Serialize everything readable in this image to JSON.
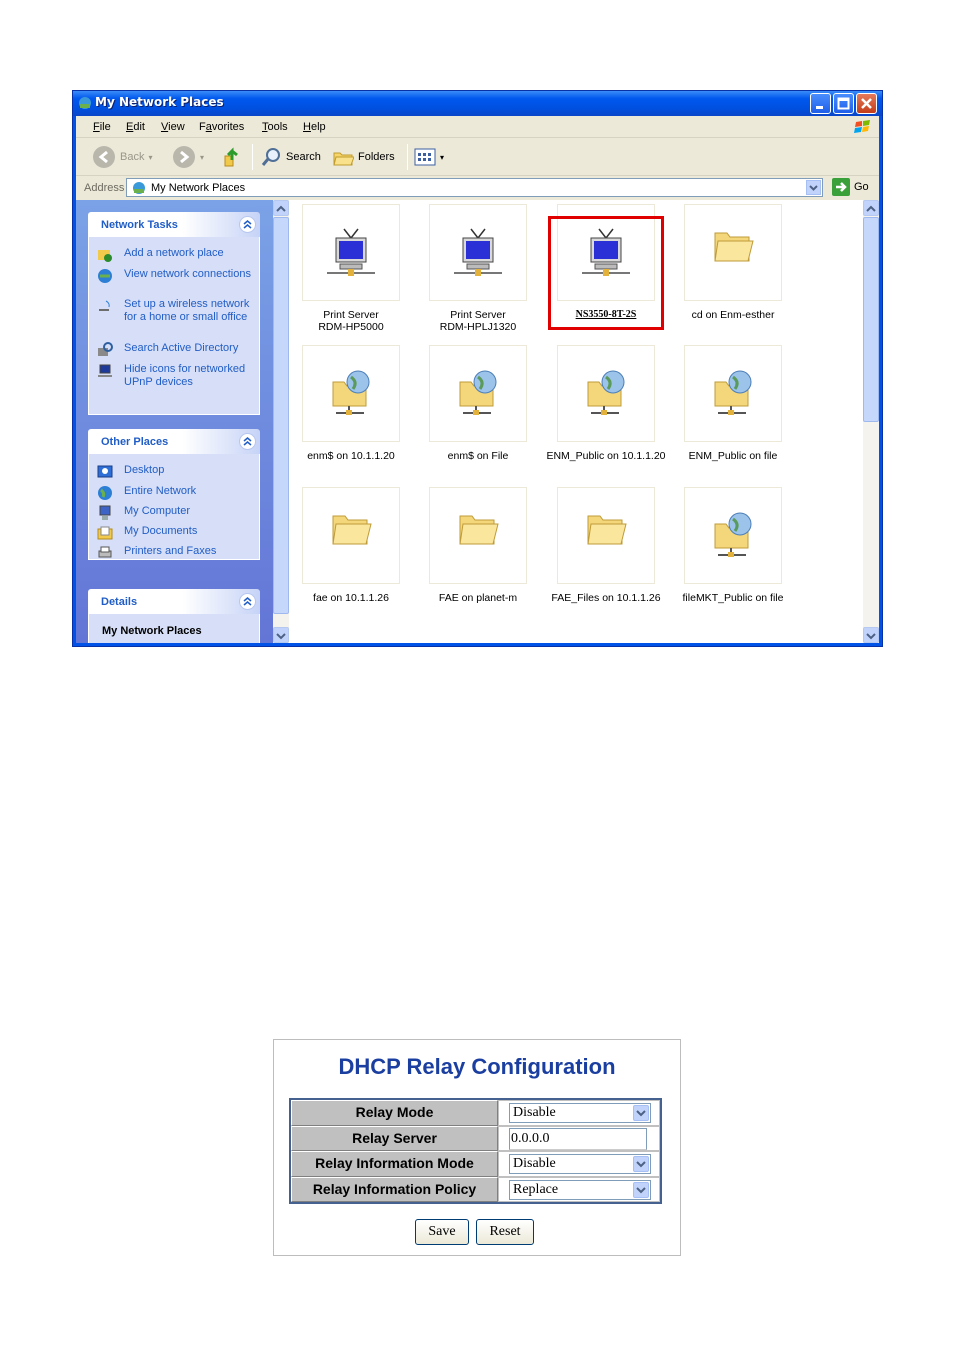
{
  "window": {
    "title": "My Network Places",
    "menu": [
      {
        "label": "File",
        "ul": "F",
        "rest": "ile"
      },
      {
        "label": "Edit",
        "ul": "E",
        "rest": "dit"
      },
      {
        "label": "View",
        "ul": "V",
        "rest": "iew"
      },
      {
        "label": "Favorites",
        "pre": "F",
        "ul": "a",
        "rest": "vorites"
      },
      {
        "label": "Tools",
        "ul": "T",
        "rest": "ools"
      },
      {
        "label": "Help",
        "ul": "H",
        "rest": "elp"
      }
    ],
    "toolbar": {
      "back": "Back",
      "search": "Search",
      "folders": "Folders"
    },
    "address": {
      "label": "Address",
      "value": "My Network Places",
      "go": "Go"
    }
  },
  "taskpane": {
    "network_tasks": {
      "title": "Network Tasks",
      "items": [
        {
          "label": "Add a network place",
          "icon": "add-network-place-icon"
        },
        {
          "label": "View network connections",
          "icon": "network-connections-icon"
        },
        {
          "label": "Set up a wireless network for a home or small office",
          "icon": "wireless-icon"
        },
        {
          "label": "Search Active Directory",
          "icon": "search-directory-icon"
        },
        {
          "label": "Hide icons for networked UPnP devices",
          "icon": "upnp-icon"
        }
      ]
    },
    "other_places": {
      "title": "Other Places",
      "items": [
        {
          "label": "Desktop",
          "icon": "desktop-icon"
        },
        {
          "label": "Entire Network",
          "icon": "globe-icon"
        },
        {
          "label": "My Computer",
          "icon": "computer-icon"
        },
        {
          "label": "My Documents",
          "icon": "documents-icon"
        },
        {
          "label": "Printers and Faxes",
          "icon": "printer-icon"
        }
      ]
    },
    "details": {
      "title": "Details",
      "subtitle": "My Network Places"
    }
  },
  "places": [
    {
      "line1": "Print Server",
      "line2": "RDM-HP5000",
      "icon": "network-device-icon"
    },
    {
      "line1": "Print Server",
      "line2": "RDM-HPLJ1320",
      "icon": "network-device-icon"
    },
    {
      "line1": "NS3550-8T-2S",
      "line2": "",
      "icon": "network-device-icon",
      "highlighted": true
    },
    {
      "line1": "cd on Enm-esther",
      "line2": "",
      "icon": "folder-icon"
    },
    {
      "line1": "enm$ on 10.1.1.20",
      "line2": "",
      "icon": "network-share-icon"
    },
    {
      "line1": "enm$ on File",
      "line2": "",
      "icon": "network-share-icon"
    },
    {
      "line1": "ENM_Public on 10.1.1.20",
      "line2": "",
      "icon": "network-share-icon"
    },
    {
      "line1": "ENM_Public on file",
      "line2": "",
      "icon": "network-share-icon"
    },
    {
      "line1": "fae on 10.1.1.26",
      "line2": "",
      "icon": "folder-icon"
    },
    {
      "line1": "FAE on planet-m",
      "line2": "",
      "icon": "folder-icon"
    },
    {
      "line1": "FAE_Files on 10.1.1.26",
      "line2": "",
      "icon": "folder-icon"
    },
    {
      "line1": "fileMKT_Public on file",
      "line2": "",
      "icon": "network-share-icon"
    }
  ],
  "dhcp": {
    "title": "DHCP Relay Configuration",
    "rows": [
      {
        "label": "Relay Mode",
        "value": "Disable",
        "kind": "select"
      },
      {
        "label": "Relay Server",
        "value": "0.0.0.0",
        "kind": "input"
      },
      {
        "label": "Relay Information Mode",
        "value": "Disable",
        "kind": "select"
      },
      {
        "label": "Relay Information Policy",
        "value": "Replace",
        "kind": "select"
      }
    ],
    "save": "Save",
    "reset": "Reset"
  },
  "colors": {
    "highlight_border": "#e00000",
    "link_blue": "#215dc6",
    "title_blue": "#1b3fa0"
  }
}
